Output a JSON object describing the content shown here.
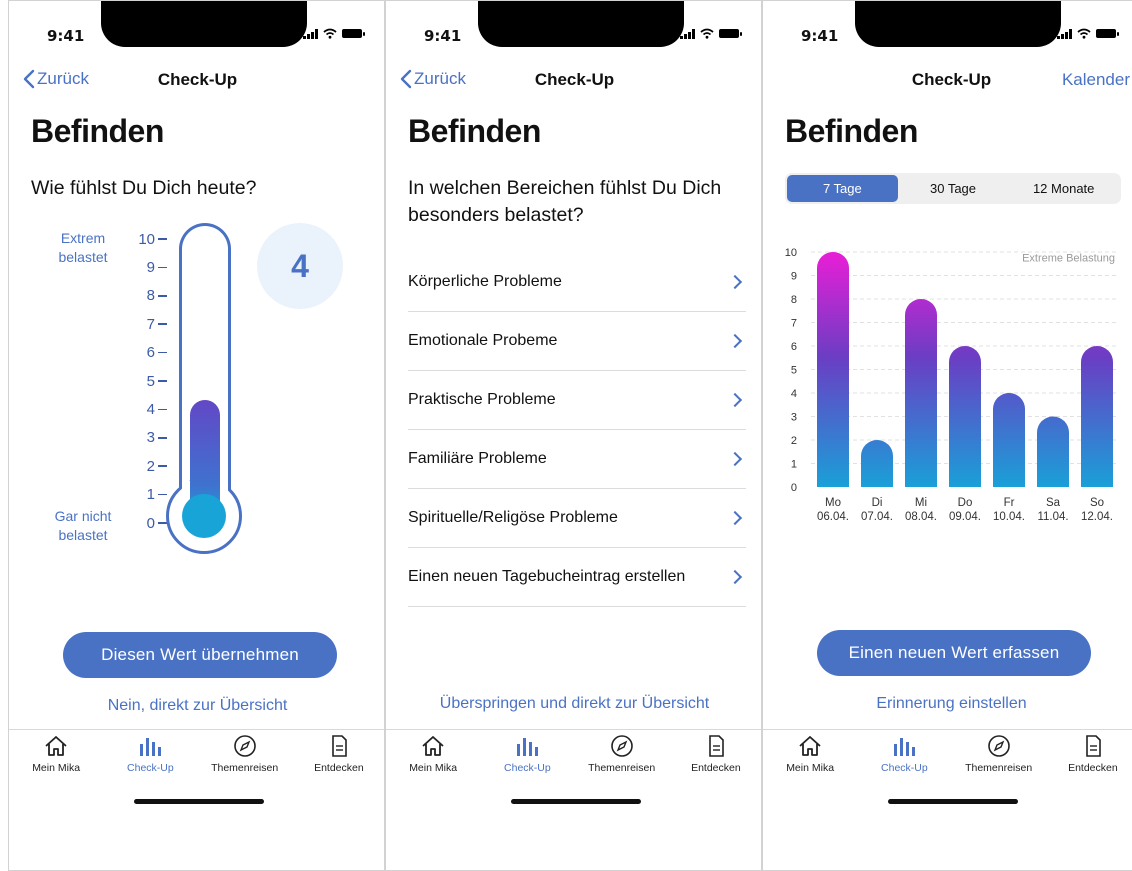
{
  "status_bar": {
    "time": "9:41"
  },
  "screens": [
    {
      "nav": {
        "back": "Zurück",
        "title": "Check-Up"
      },
      "title": "Befinden",
      "question": "Wie fühlst Du Dich heute?",
      "scale": {
        "top_label_1": "Extrem",
        "top_label_2": "belastet",
        "bottom_label_1": "Gar nicht",
        "bottom_label_2": "belastet",
        "ticks": [
          "10",
          "9",
          "8",
          "7",
          "6",
          "5",
          "4",
          "3",
          "2",
          "1",
          "0"
        ],
        "value": 4,
        "value_text": "4",
        "max": 10
      },
      "primary_button": "Diesen Wert übernehmen",
      "secondary_link": "Nein, direkt zur Übersicht"
    },
    {
      "nav": {
        "back": "Zurück",
        "title": "Check-Up"
      },
      "title": "Befinden",
      "question_1": "In welchen Bereichen fühlst Du Dich",
      "question_2": "besonders belastet?",
      "items": [
        "Körperliche Probleme",
        "Emotionale Probeme",
        "Praktische Probleme",
        "Familiäre Probleme",
        "Spirituelle/Religöse Probleme",
        "Einen neuen Tagebucheintrag erstellen"
      ],
      "secondary_link": "Überspringen und direkt zur Übersicht"
    },
    {
      "nav": {
        "title": "Check-Up",
        "right": "Kalender"
      },
      "title": "Befinden",
      "segments": [
        "7 Tage",
        "30 Tage",
        "12 Monate"
      ],
      "active_segment": 0,
      "primary_button": "Einen neuen Wert erfassen",
      "secondary_link": "Erinnerung einstellen"
    }
  ],
  "tabs": [
    "Mein Mika",
    "Check-Up",
    "Themenreisen",
    "Entdecken"
  ],
  "active_tab": 1,
  "colors": {
    "accent": "#4a72c4",
    "bar_top": "#e91ed6",
    "bar_mid": "#6a3ec4",
    "bar_bottom": "#1aa0d8"
  },
  "chart_data": {
    "type": "bar",
    "categories": [
      "Mo",
      "Di",
      "Mi",
      "Do",
      "Fr",
      "Sa",
      "So"
    ],
    "dates": [
      "06.04.",
      "07.04.",
      "08.04.",
      "09.04.",
      "10.04.",
      "11.04.",
      "12.04."
    ],
    "values": [
      10,
      2,
      8,
      6,
      4,
      3,
      6
    ],
    "ylim": [
      0,
      10
    ],
    "yticks": [
      "0",
      "1",
      "2",
      "3",
      "4",
      "5",
      "6",
      "7",
      "8",
      "9",
      "10"
    ],
    "annotation": "Extreme Belastung",
    "grid": true
  }
}
